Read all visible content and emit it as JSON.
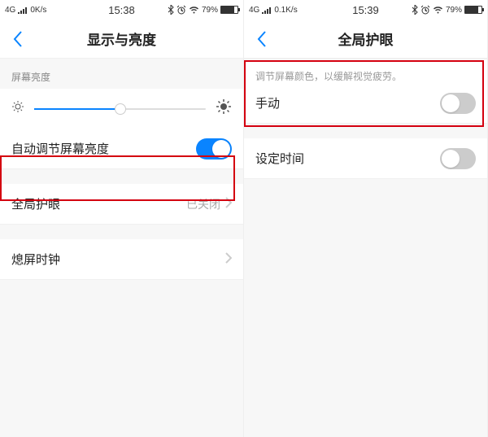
{
  "left": {
    "statusbar": {
      "net": "4G",
      "speed": "0K/s",
      "time": "15:38",
      "battery_pct": "79%"
    },
    "nav_title": "显示与亮度",
    "brightness_label": "屏幕亮度",
    "auto_brightness": "自动调节屏幕亮度",
    "eye_care": {
      "label": "全局护眼",
      "value": "已关闭"
    },
    "standby_clock": "熄屏时钟"
  },
  "right": {
    "statusbar": {
      "net": "4G",
      "speed": "0.1K/s",
      "time": "15:39",
      "battery_pct": "79%"
    },
    "nav_title": "全局护眼",
    "hint": "调节屏幕颜色，以缓解视觉疲劳。",
    "manual": "手动",
    "schedule": "设定时间"
  }
}
